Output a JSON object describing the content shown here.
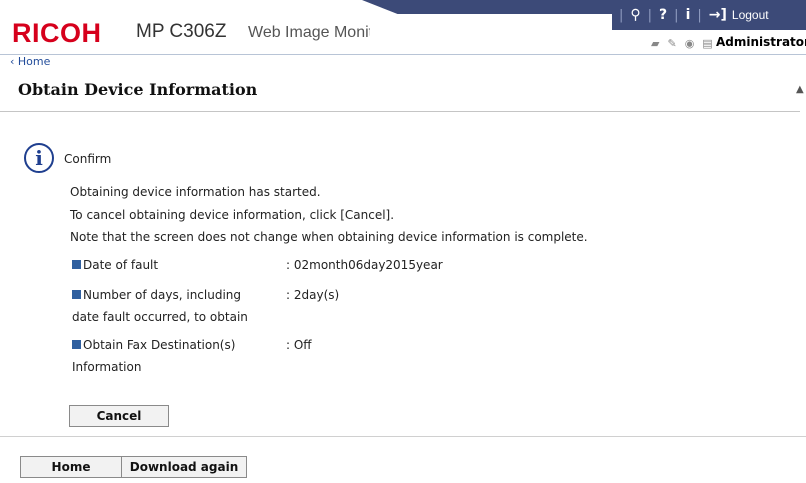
{
  "header": {
    "brand": "RICOH",
    "model": "MP C306Z",
    "app_name": "Web Image Monitor",
    "top_icons": [
      "search-icon",
      "help-icon",
      "info-icon"
    ],
    "top_glyphs": {
      "search": "⚲",
      "help": "?",
      "info": "i",
      "logout": "→]"
    },
    "logout_label": "Logout",
    "status_icons": [
      "printer-icon",
      "fax-icon",
      "user-icon",
      "document-icon"
    ],
    "user_label": "Administrator",
    "accent_color": "#3c4a78",
    "brand_color": "#d6001c"
  },
  "breadcrumb": {
    "home_label": "Home"
  },
  "page": {
    "title": "Obtain Device Information",
    "confirm_label": "Confirm",
    "messages": [
      "Obtaining device information has started.",
      "To cancel obtaining device information, click [Cancel].",
      "Note that the screen does not change when obtaining device information is complete."
    ],
    "fields": [
      {
        "label": "Date of fault",
        "value": ": 02month06day2015year"
      },
      {
        "label": "Number of days, including date fault occurred, to obtain",
        "value": ": 2day(s)"
      },
      {
        "label": "Obtain Fax Destination(s) Information",
        "value": ": Off"
      }
    ],
    "cancel_label": "Cancel"
  },
  "footer": {
    "home_label": "Home",
    "download_label": "Download again"
  }
}
